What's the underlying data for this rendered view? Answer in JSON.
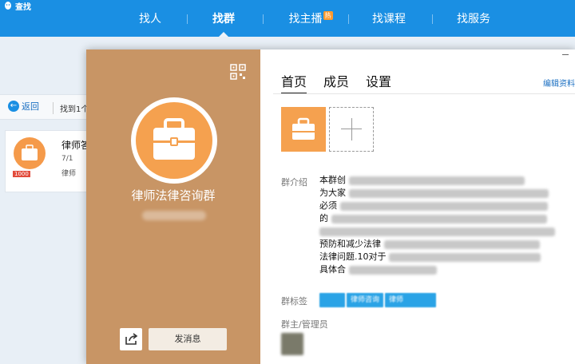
{
  "app": {
    "title": "查找"
  },
  "nav": {
    "tabs": [
      {
        "label": "找人"
      },
      {
        "label": "找群"
      },
      {
        "label": "找主播",
        "badge": "热"
      },
      {
        "label": "找课程"
      },
      {
        "label": "找服务"
      }
    ]
  },
  "background": {
    "back_label": "返回",
    "found_label": "找到1个",
    "result": {
      "title": "律师答询群",
      "count": "7/1",
      "tag": "律师",
      "badge": "1000"
    }
  },
  "modal": {
    "group_name": "律师法律咨询群",
    "send_message_label": "发消息",
    "tabs": [
      {
        "label": "首页"
      },
      {
        "label": "成员"
      },
      {
        "label": "设置"
      }
    ],
    "edit_label": "编辑资料",
    "intro_label": "群介绍",
    "intro_lines": [
      "本群创",
      "为大家",
      "必须",
      "的",
      "预防和减少法律",
      "法律问题.10对于",
      "具体合"
    ],
    "tags_label": "群标签",
    "tags": [
      "",
      "律师咨询",
      "律师"
    ],
    "admin_label": "群主/管理员"
  },
  "colors": {
    "accent": "#1a8fe3",
    "panel": "#c89565",
    "logo": "#f5a14f"
  }
}
